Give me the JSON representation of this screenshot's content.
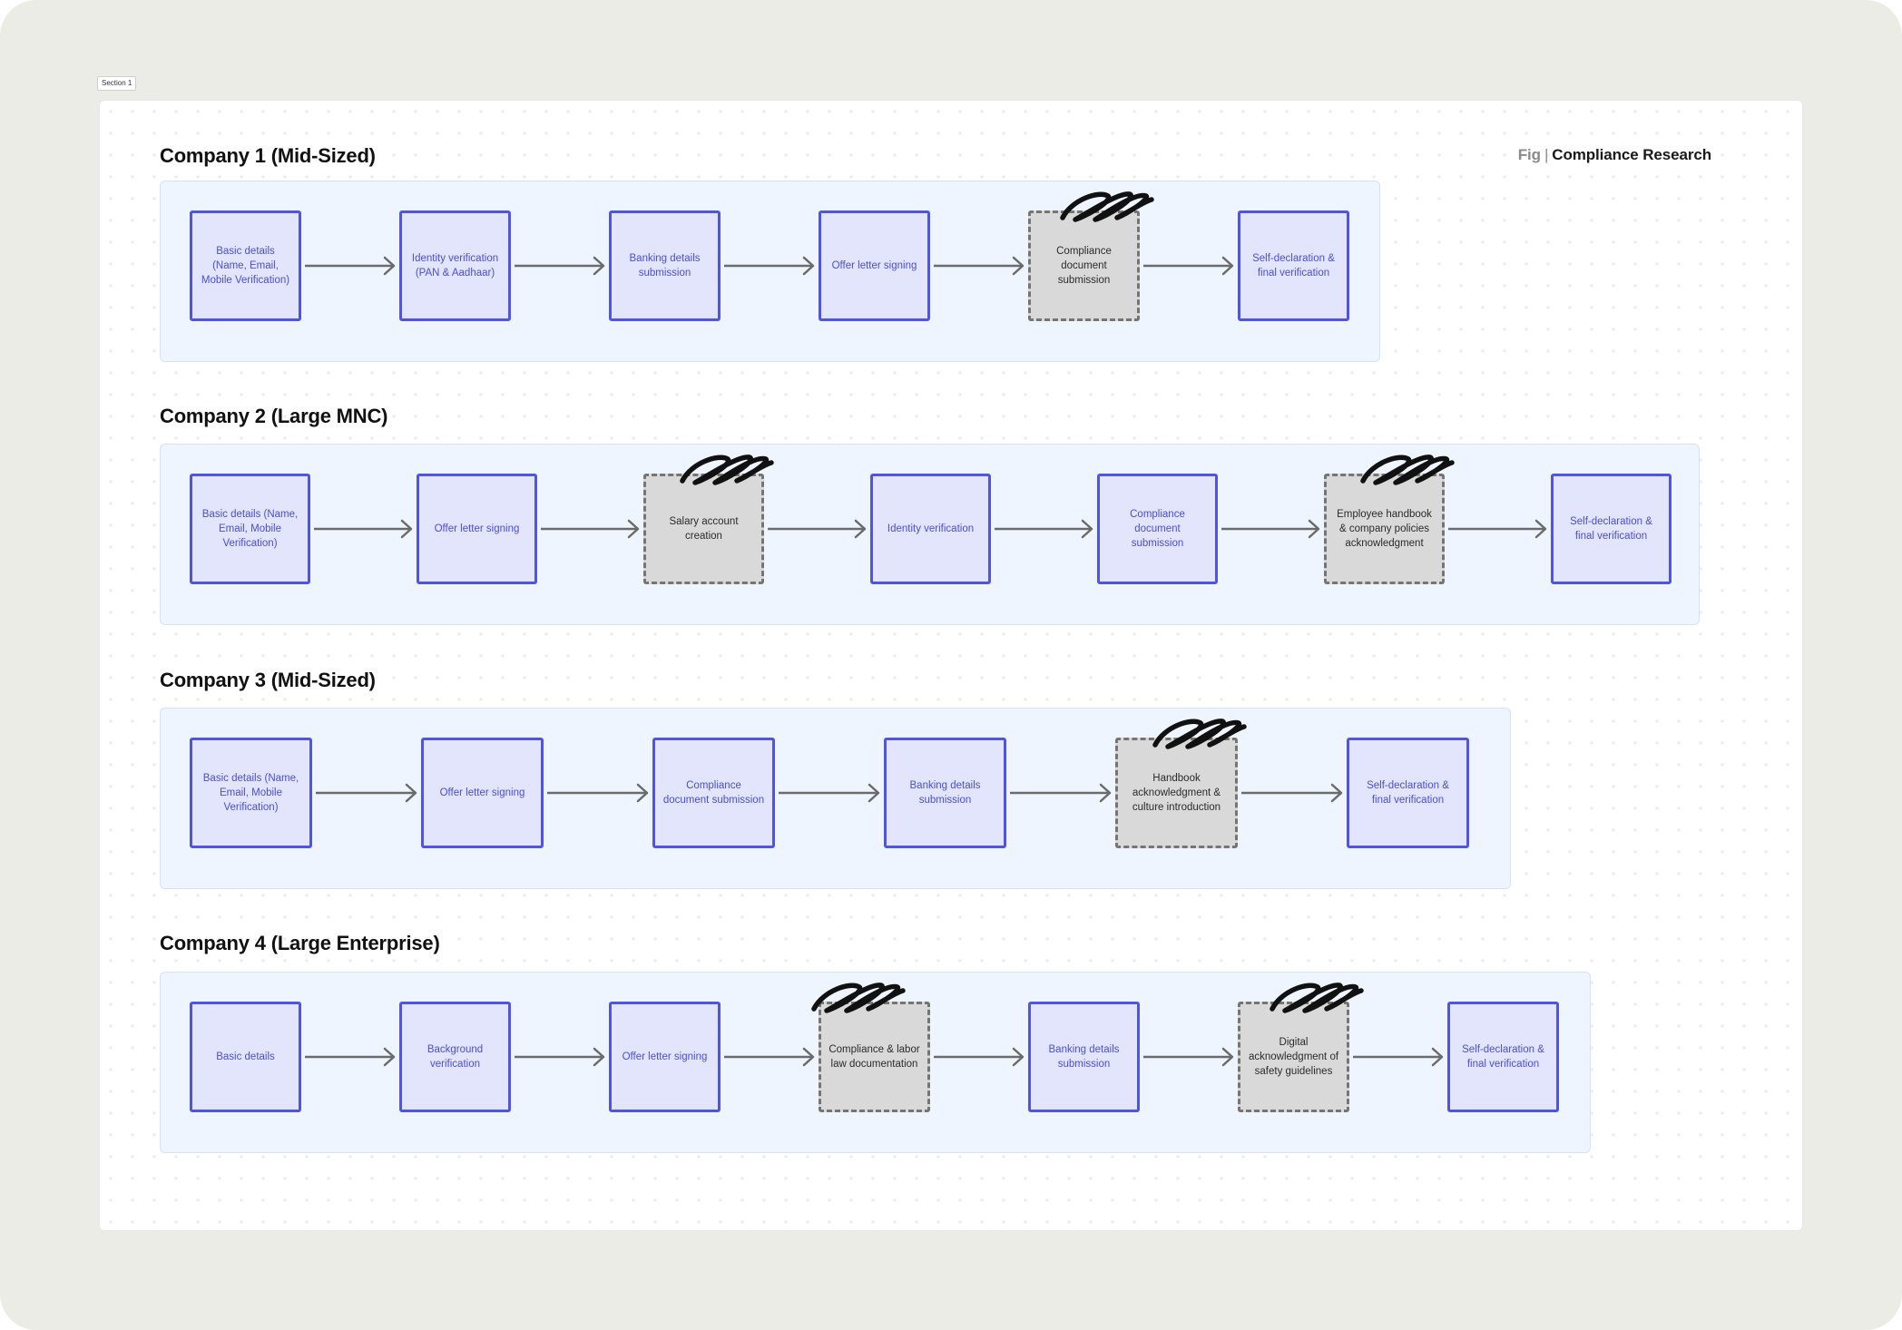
{
  "section_label": "Section 1",
  "figure_label": {
    "prefix": "Fig",
    "separator": "|",
    "title": "Compliance Research"
  },
  "companies": [
    {
      "title": "Company 1 (Mid-Sized)",
      "steps": [
        {
          "label": "Basic details (Name, Email, Mobile Verification)",
          "style": "primary"
        },
        {
          "label": "Identity verification (PAN & Aadhaar)",
          "style": "primary"
        },
        {
          "label": "Banking details submission",
          "style": "primary"
        },
        {
          "label": "Offer letter signing",
          "style": "primary"
        },
        {
          "label": "Compliance document submission",
          "style": "muted"
        },
        {
          "label": "Self-declaration & final verification",
          "style": "primary"
        }
      ]
    },
    {
      "title": "Company 2 (Large MNC)",
      "steps": [
        {
          "label": "Basic details (Name, Email, Mobile Verification)",
          "style": "primary"
        },
        {
          "label": "Offer letter signing",
          "style": "primary"
        },
        {
          "label": "Salary account creation",
          "style": "muted"
        },
        {
          "label": "Identity verification",
          "style": "primary"
        },
        {
          "label": "Compliance document submission",
          "style": "primary"
        },
        {
          "label": "Employee handbook & company policies acknowledgment",
          "style": "muted"
        },
        {
          "label": "Self-declaration & final verification",
          "style": "primary"
        }
      ]
    },
    {
      "title": "Company 3 (Mid-Sized)",
      "steps": [
        {
          "label": "Basic details (Name, Email, Mobile Verification)",
          "style": "primary"
        },
        {
          "label": "Offer letter signing",
          "style": "primary"
        },
        {
          "label": "Compliance document submission",
          "style": "primary"
        },
        {
          "label": "Banking details submission",
          "style": "primary"
        },
        {
          "label": "Handbook acknowledgment & culture introduction",
          "style": "muted"
        },
        {
          "label": "Self-declaration & final verification",
          "style": "primary"
        }
      ]
    },
    {
      "title": "Company 4 (Large Enterprise)",
      "steps": [
        {
          "label": "Basic details",
          "style": "primary"
        },
        {
          "label": "Background verification",
          "style": "primary"
        },
        {
          "label": "Offer letter signing",
          "style": "primary"
        },
        {
          "label": "Compliance & labor law documentation",
          "style": "muted"
        },
        {
          "label": "Banking details submission",
          "style": "primary"
        },
        {
          "label": "Digital acknowledgment of safety guidelines",
          "style": "muted"
        },
        {
          "label": "Self-declaration & final verification",
          "style": "primary"
        }
      ]
    }
  ],
  "colors": {
    "primary_fill": "#e3e5fd",
    "primary_border": "#4f54e4",
    "primary_text": "#4a4ed8",
    "muted_fill": "#d9d9d9",
    "muted_border": "#757575",
    "panel_fill": "#eff5fe",
    "arrow": "#6b6b6b",
    "scribble": "#111111"
  }
}
